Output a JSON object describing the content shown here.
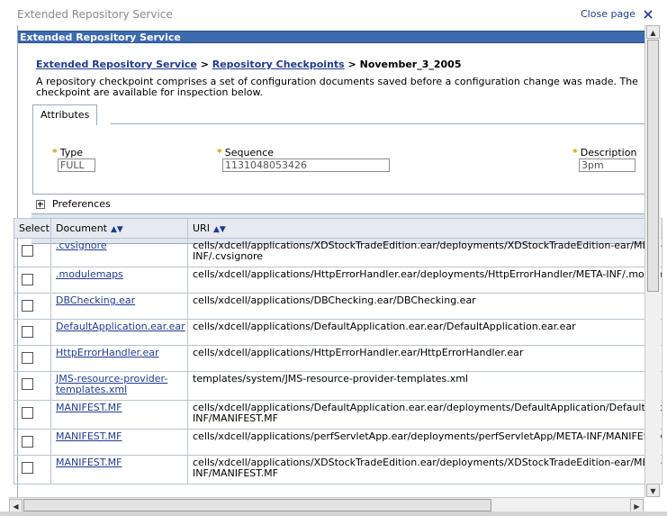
{
  "header": {
    "title": "Extended Repository Service",
    "close_label": "Close page"
  },
  "portlet": {
    "title": "Extended Repository Service"
  },
  "breadcrumb": {
    "link1": "Extended Repository Service",
    "sep1": " > ",
    "link2": "Repository Checkpoints",
    "sep2": " > ",
    "current": "November_3_2005"
  },
  "description": "A repository checkpoint comprises a set of configuration documents saved before a configuration change was made. The checkpoint are available for inspection below.",
  "tabs": [
    {
      "label": "Attributes"
    }
  ],
  "fields": {
    "type": {
      "label": "Type",
      "value": "FULL"
    },
    "sequence": {
      "label": "Sequence",
      "value": "1131048053426"
    },
    "description": {
      "label": "Description",
      "value": "3pm"
    }
  },
  "required_marker": "*",
  "preferences_label": "Preferences",
  "table": {
    "headers": {
      "select": "Select",
      "document": "Document",
      "uri": "URI"
    },
    "rows": [
      {
        "document": ".cvsignore",
        "uri": "cells/xdcell/applications/XDStockTradeEdition.ear/deployments/XDStockTradeEdition-ear/META-",
        "uri2": "INF/.cvsignore"
      },
      {
        "document": ".modulemaps",
        "uri": "cells/xdcell/applications/HttpErrorHandler.ear/deployments/HttpErrorHandler/META-INF/.modulemaps",
        "uri2": ""
      },
      {
        "document": "DBChecking.ear",
        "uri": "cells/xdcell/applications/DBChecking.ear/DBChecking.ear",
        "uri2": ""
      },
      {
        "document": "DefaultApplication.ear.ear",
        "uri": "cells/xdcell/applications/DefaultApplication.ear.ear/DefaultApplication.ear.ear",
        "uri2": ""
      },
      {
        "document": "HttpErrorHandler.ear",
        "uri": "cells/xdcell/applications/HttpErrorHandler.ear/HttpErrorHandler.ear",
        "uri2": ""
      },
      {
        "document": "JMS-resource-provider-",
        "document2": "templates.xml",
        "uri": "templates/system/JMS-resource-provider-templates.xml",
        "uri2": ""
      },
      {
        "document": "MANIFEST.MF",
        "uri": "cells/xdcell/applications/DefaultApplication.ear.ear/deployments/DefaultApplication/DefaultApplication.war/META-",
        "uri2": "INF/MANIFEST.MF"
      },
      {
        "document": "MANIFEST.MF",
        "uri": "cells/xdcell/applications/perfServletApp.ear/deployments/perfServletApp/META-INF/MANIFEST.MF",
        "uri2": ""
      },
      {
        "document": "MANIFEST.MF",
        "uri": "cells/xdcell/applications/XDStockTradeEdition.ear/deployments/XDStockTradeEdition-ear/META-",
        "uri2": "INF/MANIFEST.MF"
      }
    ]
  },
  "icons": {
    "close": "close-icon",
    "expand": "plus-box-icon",
    "toolbar": [
      "select-all-icon",
      "deselect-all-icon",
      "expand-all-icon",
      "filter-icon"
    ],
    "sort": "sort-updown-icon",
    "scroll": [
      "scroll-up-icon",
      "scroll-down-icon",
      "scroll-left-icon",
      "scroll-right-icon"
    ]
  },
  "colors": {
    "title_bar": "#3d6aad",
    "link": "#1f3b8f",
    "table_header": "#e6eaf0",
    "toolbar_bg": "#dfe5ee",
    "required": "#c9a000"
  }
}
